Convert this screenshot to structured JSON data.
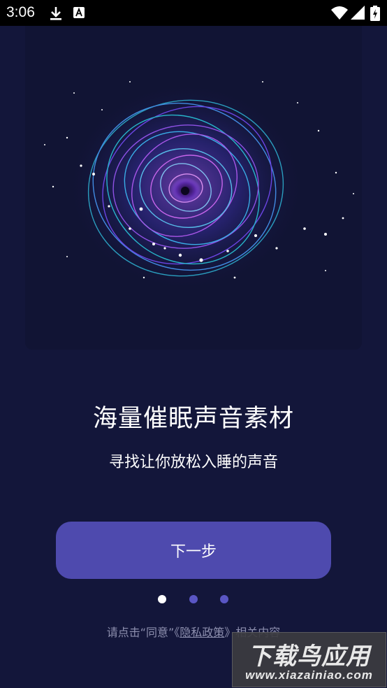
{
  "status_bar": {
    "time": "3:06",
    "icons": [
      "download-icon",
      "app-notification-icon",
      "wifi-icon",
      "signal-icon",
      "battery-icon"
    ]
  },
  "onboarding": {
    "title": "海量催眠声音素材",
    "subtitle": "寻找让你放松入睡的声音",
    "next_button_label": "下一步",
    "page_count": 3,
    "active_page": 1
  },
  "consent": {
    "prefix": "请点击“同意”《",
    "link_text": "隐私政策",
    "suffix": "》相关内容"
  },
  "watermark": {
    "name": "下载鸟应用",
    "url": "www.xiazainiao.com"
  },
  "colors": {
    "background": "#13163a",
    "button": "#4e4aae",
    "dot_active": "#ffffff",
    "dot_inactive": "#5a56c4"
  }
}
